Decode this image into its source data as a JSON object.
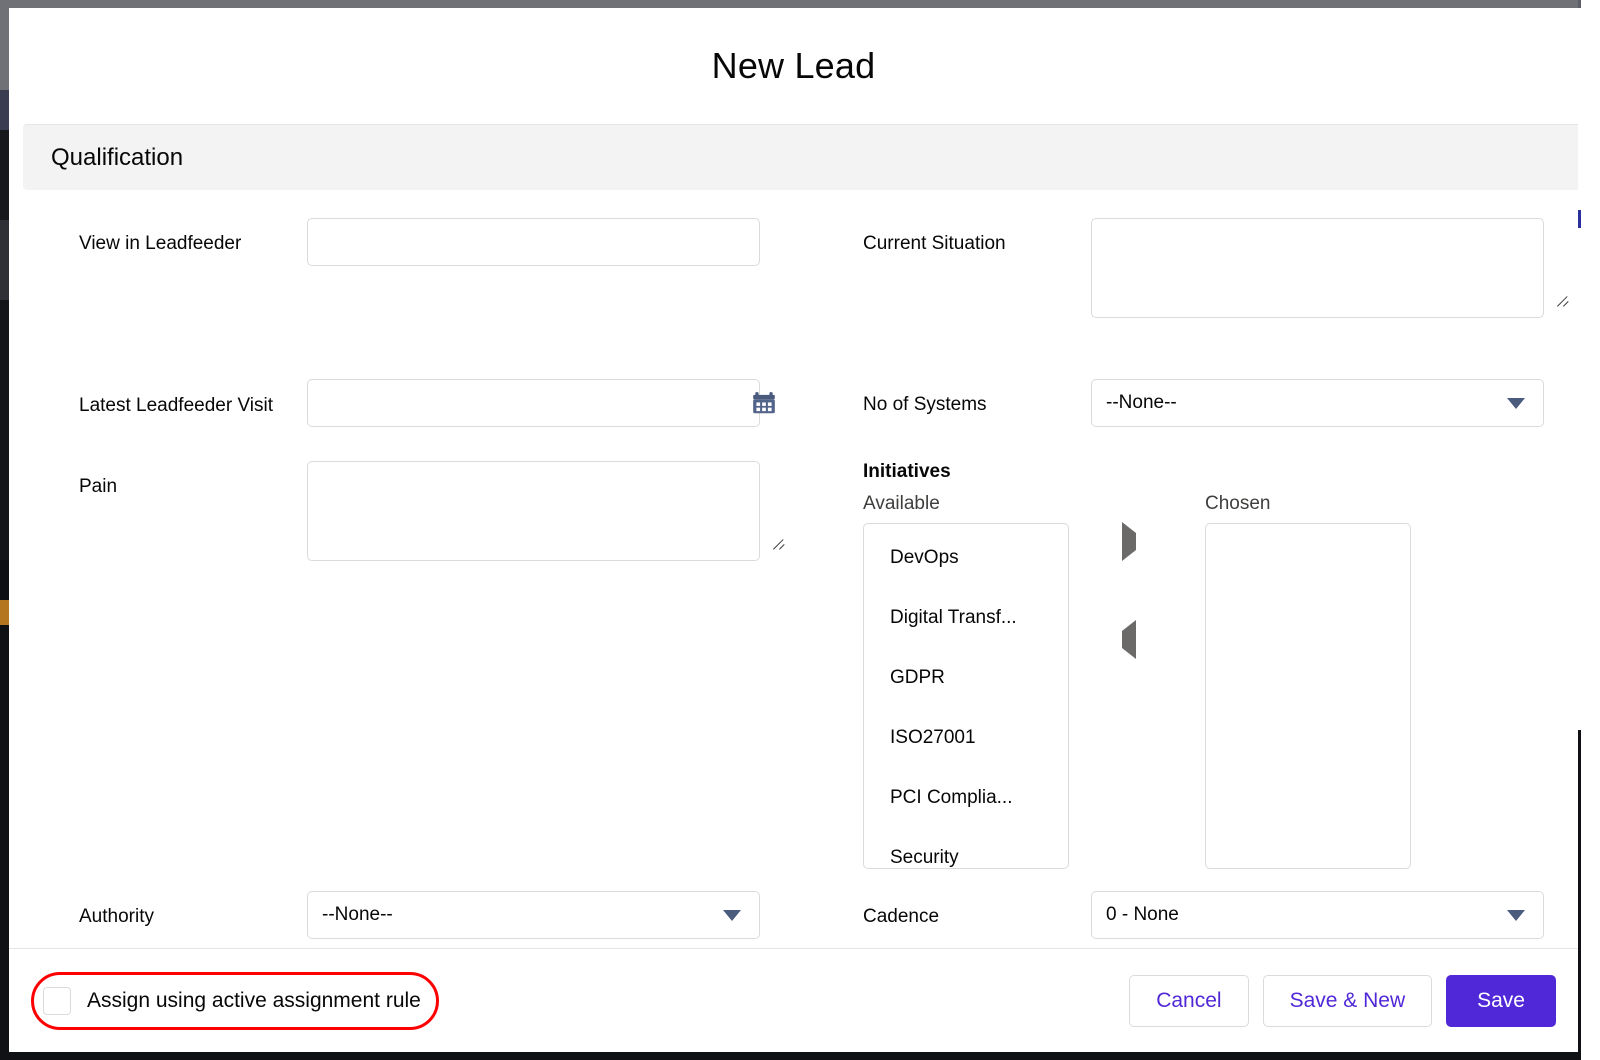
{
  "modal": {
    "title": "New Lead"
  },
  "section": {
    "title": "Qualification"
  },
  "fields": {
    "view_in_leadfeeder": {
      "label": "View in Leadfeeder",
      "value": "",
      "placeholder": ""
    },
    "latest_leadfeeder_visit": {
      "label": "Latest Leadfeeder Visit",
      "value": "",
      "placeholder": "",
      "icon": "calendar-icon"
    },
    "pain": {
      "label": "Pain",
      "value": "",
      "placeholder": ""
    },
    "current_situation": {
      "label": "Current Situation",
      "value": "",
      "placeholder": ""
    },
    "no_of_systems": {
      "label": "No of Systems",
      "value": "--None--"
    },
    "authority": {
      "label": "Authority",
      "value": "--None--"
    },
    "cadence": {
      "label": "Cadence",
      "value": "0 - None"
    }
  },
  "initiatives": {
    "title": "Initiatives",
    "available_label": "Available",
    "chosen_label": "Chosen",
    "available": [
      "DevOps",
      "Digital Transf...",
      "GDPR",
      "ISO27001",
      "PCI Complia...",
      "Security"
    ],
    "chosen": [],
    "move_right_icon": "triangle-right-icon",
    "move_left_icon": "triangle-left-icon"
  },
  "footer": {
    "assign_checkbox_label": "Assign using active assignment rule",
    "assign_checked": false,
    "buttons": {
      "cancel": "Cancel",
      "save_new": "Save & New",
      "save": "Save"
    }
  },
  "colors": {
    "brand": "#5128d8",
    "section_band": "#f3f3f3",
    "border": "#dddbda",
    "icon_blue": "#4a5b7d",
    "highlight_red": "#ff0000",
    "arrow_gray": "#6b6a68"
  }
}
